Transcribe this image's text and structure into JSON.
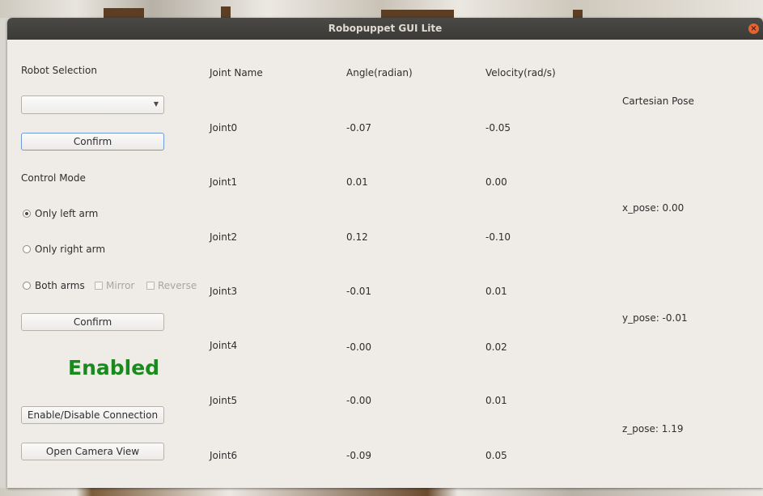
{
  "window": {
    "title": "Robopuppet GUI Lite"
  },
  "left_panel": {
    "robot_selection_label": "Robot Selection",
    "robot_selection_value": "",
    "confirm_robot_label": "Confirm",
    "control_mode_label": "Control Mode",
    "modes": {
      "only_left": "Only left arm",
      "only_right": "Only right arm",
      "both": "Both arms",
      "mirror": "Mirror",
      "reverse": "Reverse"
    },
    "selected_mode": "Only left arm",
    "confirm_mode_label": "Confirm",
    "status_text": "Enabled",
    "status_color": "#1a8a1f",
    "enable_disable_label": "Enable/Disable Connection",
    "open_camera_label": "Open Camera View"
  },
  "joint_table": {
    "headers": {
      "name": "Joint Name",
      "angle": "Angle(radian)",
      "velocity": "Velocity(rad/s)"
    },
    "rows": [
      {
        "name": "Joint0",
        "angle": "-0.07",
        "velocity": "-0.05"
      },
      {
        "name": "Joint1",
        "angle": "0.01",
        "velocity": "0.00"
      },
      {
        "name": "Joint2",
        "angle": "0.12",
        "velocity": "-0.10"
      },
      {
        "name": "Joint3",
        "angle": "-0.01",
        "velocity": "0.01"
      },
      {
        "name": "Joint4",
        "angle": "-0.00",
        "velocity": "0.02"
      },
      {
        "name": "Joint5",
        "angle": "-0.00",
        "velocity": "0.01"
      },
      {
        "name": "Joint6",
        "angle": "-0.09",
        "velocity": "0.05"
      }
    ]
  },
  "cartesian": {
    "title": "Cartesian Pose",
    "x": "x_pose: 0.00",
    "y": "y_pose: -0.01",
    "z": "z_pose: 1.19"
  }
}
